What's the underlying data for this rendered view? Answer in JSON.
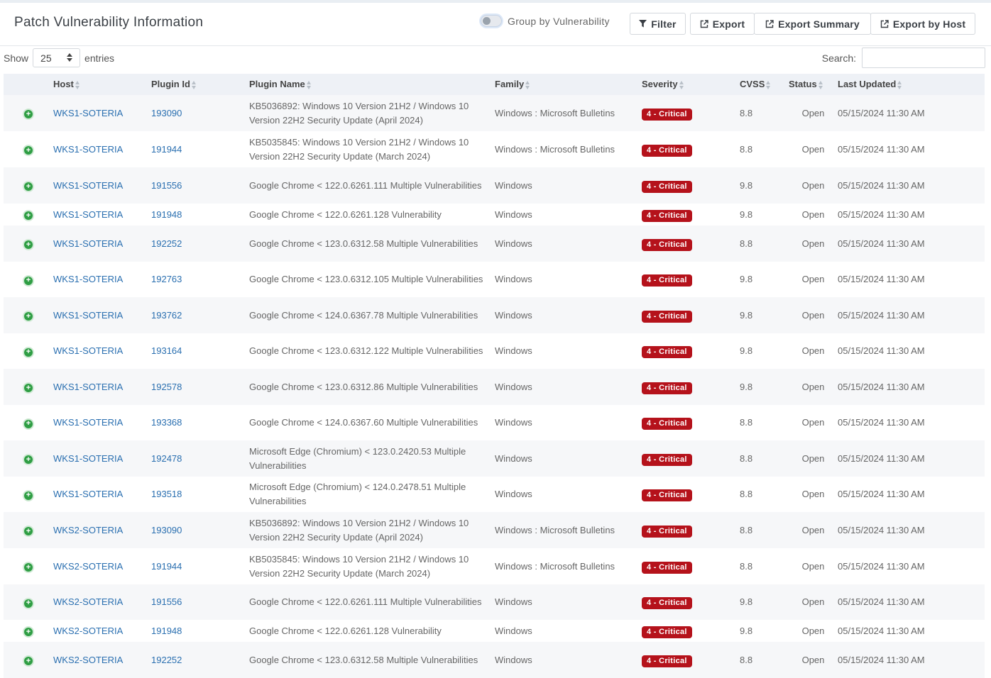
{
  "header": {
    "title": "Patch Vulnerability Information",
    "toggle_label": "Group by Vulnerability",
    "filter_label": "Filter",
    "export_label": "Export",
    "export_summary_label": "Export Summary",
    "export_host_label": "Export by Host"
  },
  "controls": {
    "show_label": "Show",
    "entries_value": "25",
    "entries_label": "entries",
    "search_label": "Search:",
    "search_value": ""
  },
  "columns": [
    "Host",
    "Plugin Id",
    "Plugin Name",
    "Family",
    "Severity",
    "CVSS",
    "Status",
    "Last Updated"
  ],
  "rows": [
    {
      "host": "WKS1-SOTERIA",
      "plugin_id": "193090",
      "name": "KB5036892: Windows 10 Version 21H2 / Windows 10 Version 22H2 Security Update (April 2024)",
      "family": "Windows : Microsoft Bulletins",
      "severity": "4 - Critical",
      "cvss": "8.8",
      "status": "Open",
      "updated": "05/15/2024 11:30 AM"
    },
    {
      "host": "WKS1-SOTERIA",
      "plugin_id": "191944",
      "name": "KB5035845: Windows 10 Version 21H2 / Windows 10 Version 22H2 Security Update (March 2024)",
      "family": "Windows : Microsoft Bulletins",
      "severity": "4 - Critical",
      "cvss": "8.8",
      "status": "Open",
      "updated": "05/15/2024 11:30 AM"
    },
    {
      "host": "WKS1-SOTERIA",
      "plugin_id": "191556",
      "name": "Google Chrome < 122.0.6261.111 Multiple Vulnerabilities",
      "family": "Windows",
      "severity": "4 - Critical",
      "cvss": "9.8",
      "status": "Open",
      "updated": "05/15/2024 11:30 AM"
    },
    {
      "host": "WKS1-SOTERIA",
      "plugin_id": "191948",
      "name": "Google Chrome < 122.0.6261.128 Vulnerability",
      "family": "Windows",
      "severity": "4 - Critical",
      "cvss": "9.8",
      "status": "Open",
      "updated": "05/15/2024 11:30 AM"
    },
    {
      "host": "WKS1-SOTERIA",
      "plugin_id": "192252",
      "name": "Google Chrome < 123.0.6312.58 Multiple Vulnerabilities",
      "family": "Windows",
      "severity": "4 - Critical",
      "cvss": "8.8",
      "status": "Open",
      "updated": "05/15/2024 11:30 AM"
    },
    {
      "host": "WKS1-SOTERIA",
      "plugin_id": "192763",
      "name": "Google Chrome < 123.0.6312.105 Multiple Vulnerabilities",
      "family": "Windows",
      "severity": "4 - Critical",
      "cvss": "9.8",
      "status": "Open",
      "updated": "05/15/2024 11:30 AM"
    },
    {
      "host": "WKS1-SOTERIA",
      "plugin_id": "193762",
      "name": "Google Chrome < 124.0.6367.78 Multiple Vulnerabilities",
      "family": "Windows",
      "severity": "4 - Critical",
      "cvss": "9.8",
      "status": "Open",
      "updated": "05/15/2024 11:30 AM"
    },
    {
      "host": "WKS1-SOTERIA",
      "plugin_id": "193164",
      "name": "Google Chrome < 123.0.6312.122 Multiple Vulnerabilities",
      "family": "Windows",
      "severity": "4 - Critical",
      "cvss": "9.8",
      "status": "Open",
      "updated": "05/15/2024 11:30 AM"
    },
    {
      "host": "WKS1-SOTERIA",
      "plugin_id": "192578",
      "name": "Google Chrome < 123.0.6312.86 Multiple Vulnerabilities",
      "family": "Windows",
      "severity": "4 - Critical",
      "cvss": "9.8",
      "status": "Open",
      "updated": "05/15/2024 11:30 AM"
    },
    {
      "host": "WKS1-SOTERIA",
      "plugin_id": "193368",
      "name": "Google Chrome < 124.0.6367.60 Multiple Vulnerabilities",
      "family": "Windows",
      "severity": "4 - Critical",
      "cvss": "8.8",
      "status": "Open",
      "updated": "05/15/2024 11:30 AM"
    },
    {
      "host": "WKS1-SOTERIA",
      "plugin_id": "192478",
      "name": "Microsoft Edge (Chromium) < 123.0.2420.53 Multiple Vulnerabilities",
      "family": "Windows",
      "severity": "4 - Critical",
      "cvss": "8.8",
      "status": "Open",
      "updated": "05/15/2024 11:30 AM"
    },
    {
      "host": "WKS1-SOTERIA",
      "plugin_id": "193518",
      "name": "Microsoft Edge (Chromium) < 124.0.2478.51 Multiple Vulnerabilities",
      "family": "Windows",
      "severity": "4 - Critical",
      "cvss": "8.8",
      "status": "Open",
      "updated": "05/15/2024 11:30 AM"
    },
    {
      "host": "WKS2-SOTERIA",
      "plugin_id": "193090",
      "name": "KB5036892: Windows 10 Version 21H2 / Windows 10 Version 22H2 Security Update (April 2024)",
      "family": "Windows : Microsoft Bulletins",
      "severity": "4 - Critical",
      "cvss": "8.8",
      "status": "Open",
      "updated": "05/15/2024 11:30 AM"
    },
    {
      "host": "WKS2-SOTERIA",
      "plugin_id": "191944",
      "name": "KB5035845: Windows 10 Version 21H2 / Windows 10 Version 22H2 Security Update (March 2024)",
      "family": "Windows : Microsoft Bulletins",
      "severity": "4 - Critical",
      "cvss": "8.8",
      "status": "Open",
      "updated": "05/15/2024 11:30 AM"
    },
    {
      "host": "WKS2-SOTERIA",
      "plugin_id": "191556",
      "name": "Google Chrome < 122.0.6261.111 Multiple Vulnerabilities",
      "family": "Windows",
      "severity": "4 - Critical",
      "cvss": "9.8",
      "status": "Open",
      "updated": "05/15/2024 11:30 AM"
    },
    {
      "host": "WKS2-SOTERIA",
      "plugin_id": "191948",
      "name": "Google Chrome < 122.0.6261.128 Vulnerability",
      "family": "Windows",
      "severity": "4 - Critical",
      "cvss": "9.8",
      "status": "Open",
      "updated": "05/15/2024 11:30 AM"
    },
    {
      "host": "WKS2-SOTERIA",
      "plugin_id": "192252",
      "name": "Google Chrome < 123.0.6312.58 Multiple Vulnerabilities",
      "family": "Windows",
      "severity": "4 - Critical",
      "cvss": "8.8",
      "status": "Open",
      "updated": "05/15/2024 11:30 AM"
    }
  ],
  "colors": {
    "accent_link": "#2a6fb0",
    "critical": "#b5121b",
    "expand": "#2f9e44"
  },
  "icons": {
    "expand": "plus-circle-icon",
    "filter": "filter-icon",
    "export": "external-link-icon",
    "sort": "sort-icon"
  }
}
